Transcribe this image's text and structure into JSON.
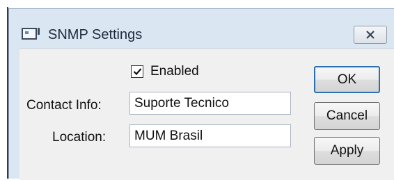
{
  "window": {
    "title": "SNMP Settings",
    "app_icon": "window-icon",
    "close_icon": "close-x-icon"
  },
  "form": {
    "enabled": {
      "label": "Enabled",
      "checked": true
    },
    "contact_info": {
      "label": "Contact Info:",
      "value": "Suporte Tecnico"
    },
    "location": {
      "label": "Location:",
      "value": "MUM Brasil"
    }
  },
  "buttons": {
    "ok": "OK",
    "cancel": "Cancel",
    "apply": "Apply"
  }
}
